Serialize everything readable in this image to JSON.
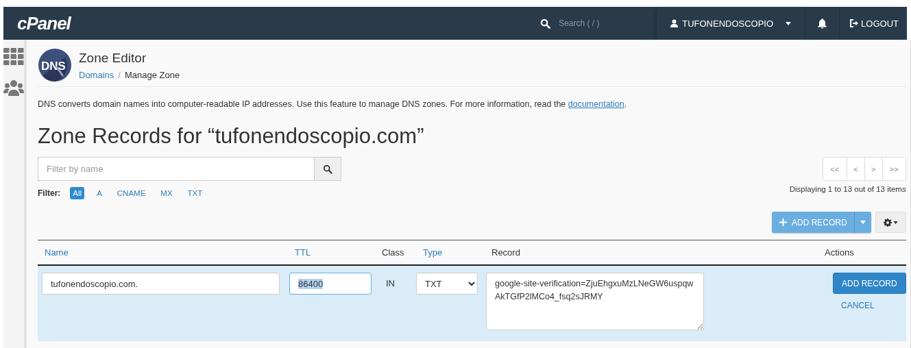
{
  "topbar": {
    "logo": "cPanel",
    "search_placeholder": "Search ( / )",
    "user": "TUFONENDOSCOPIO",
    "logout": "LOGOUT"
  },
  "header": {
    "icon_text": "DNS",
    "title": "Zone Editor",
    "separator": "/",
    "breadcrumb": [
      {
        "label": "Domains",
        "kind": "link"
      },
      {
        "label": "Manage Zone",
        "kind": "current"
      }
    ]
  },
  "description": {
    "text": "DNS converts domain names into computer-readable IP addresses. Use this feature to manage DNS zones. For more information, read the ",
    "link": "documentation",
    "end": "."
  },
  "heading": "Zone Records for “tufonendoscopio.com”",
  "filter": {
    "placeholder": "Filter by name",
    "label": "Filter:",
    "types": [
      {
        "label": "All",
        "selected": true
      },
      {
        "label": "A",
        "selected": false
      },
      {
        "label": "CNAME",
        "selected": false
      },
      {
        "label": "MX",
        "selected": false
      },
      {
        "label": "TXT",
        "selected": false
      }
    ]
  },
  "pagination": {
    "buttons": [
      "<<",
      "<",
      ">",
      ">>"
    ],
    "summary": "Displaying 1 to 13 out of 13 items"
  },
  "add_record_button": "ADD RECORD",
  "table": {
    "columns": [
      {
        "label": "Name",
        "sortable": true
      },
      {
        "label": "TTL",
        "sortable": true
      },
      {
        "label": "Class",
        "sortable": false
      },
      {
        "label": "Type",
        "sortable": true
      },
      {
        "label": "Record",
        "sortable": false
      },
      {
        "label": "Actions",
        "sortable": false
      }
    ],
    "edit_row": {
      "name": "tufonendoscopio.com.",
      "ttl": "86400",
      "ttl_selected": true,
      "class": "IN",
      "type": "TXT",
      "record": "google-site-verification=ZjuEhgxuMzLNeGW6uspqwAkTGfP2lMCo4_fsq2sJRMY",
      "save": "ADD RECORD",
      "cancel": "CANCEL"
    }
  }
}
